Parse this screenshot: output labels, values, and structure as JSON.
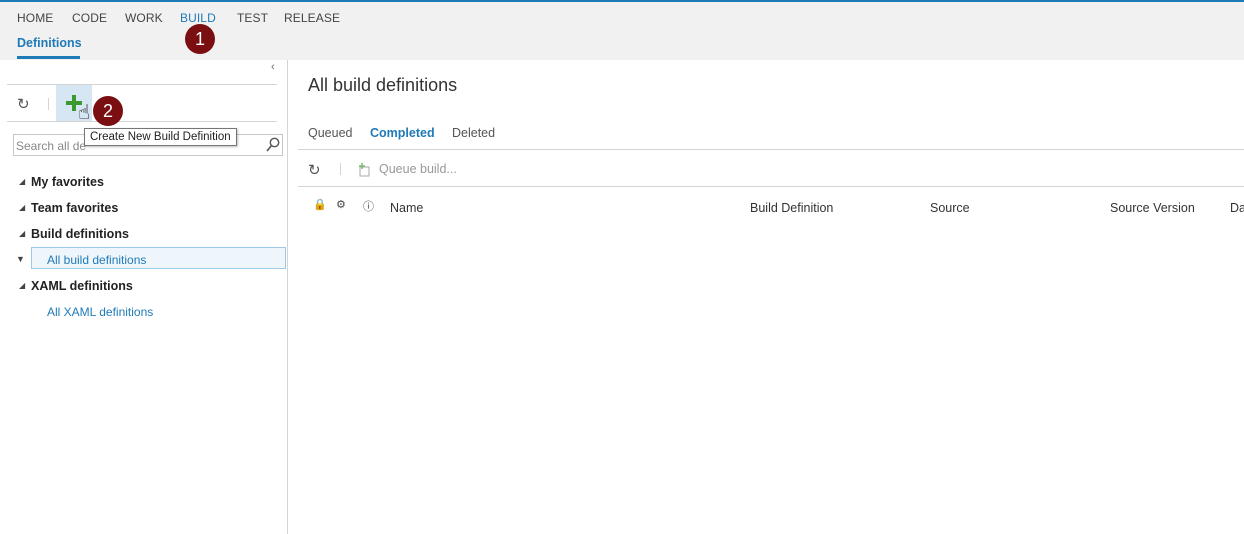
{
  "nav": {
    "items": [
      "HOME",
      "CODE",
      "WORK",
      "BUILD",
      "TEST",
      "RELEASE"
    ],
    "active": "BUILD",
    "sub_item": "Definitions"
  },
  "callouts": [
    "1",
    "2"
  ],
  "left_panel": {
    "tooltip": "Create New Build Definition",
    "search_placeholder": "Search all de",
    "tree": {
      "my_favorites": "My favorites",
      "team_favorites": "Team favorites",
      "build_definitions": "Build definitions",
      "all_build_definitions": "All build definitions",
      "xaml_definitions": "XAML definitions",
      "all_xaml_definitions": "All XAML definitions"
    }
  },
  "main": {
    "title": "All build definitions",
    "tabs": [
      "Queued",
      "Completed",
      "Deleted"
    ],
    "active_tab": "Completed",
    "queue_build_label": "Queue build...",
    "columns": [
      "Name",
      "Build Definition",
      "Source",
      "Source Version",
      "Da"
    ]
  },
  "colors": {
    "accent": "#1f7ab8",
    "callout": "#7b0e10",
    "add_icon": "#3a9a2e"
  }
}
